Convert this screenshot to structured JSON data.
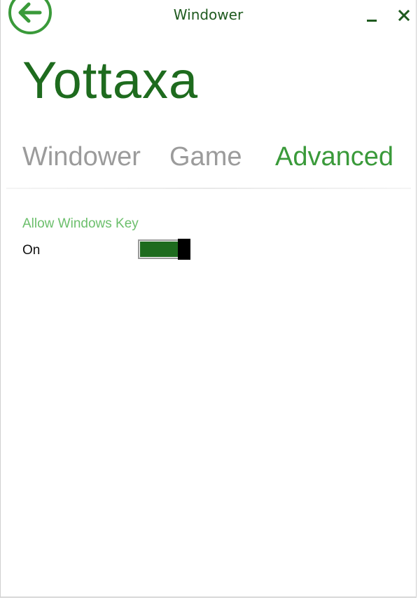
{
  "window": {
    "title": "Windower",
    "controls": {
      "back_icon": "arrow-left-circle-icon",
      "minimize_icon": "minimize-icon",
      "close_icon": "close-icon"
    }
  },
  "app": {
    "title": "Yottaxa"
  },
  "tabs": [
    {
      "label": "Windower",
      "active": false
    },
    {
      "label": "Game",
      "active": false
    },
    {
      "label": "Advanced",
      "active": true
    }
  ],
  "settings": {
    "allow_windows_key": {
      "label": "Allow Windows Key",
      "state_text": "On",
      "on": true
    }
  },
  "colors": {
    "accent": "#3a9a3a",
    "accent_dark": "#1e6b1e",
    "label_green": "#6cbf6c",
    "inactive_tab": "#9b9b9b"
  }
}
